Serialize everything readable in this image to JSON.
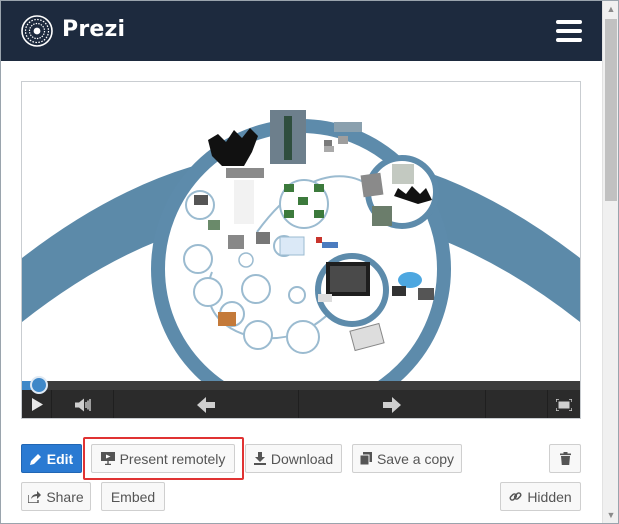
{
  "app": {
    "brand": "Prezi",
    "logo_icon": "prezi-logo-icon",
    "menu_icon": "hamburger-menu-icon",
    "header_color": "#1d2a3e"
  },
  "preview": {
    "controls": {
      "play_icon": "play-icon",
      "volume_icon": "volume-icon",
      "prev_icon": "arrow-left-icon",
      "next_icon": "arrow-right-icon",
      "fullscreen_icon": "fullscreen-icon",
      "progress": 0.03,
      "accent": "#3f88c8"
    }
  },
  "actions": {
    "edit": "Edit",
    "present_remotely": "Present remotely",
    "download": "Download",
    "save_copy": "Save a copy",
    "delete_icon": "trash-icon",
    "share": "Share",
    "embed": "Embed",
    "hidden": "Hidden",
    "primary_color": "#2a7ad2",
    "highlight_color": "#e03333"
  }
}
